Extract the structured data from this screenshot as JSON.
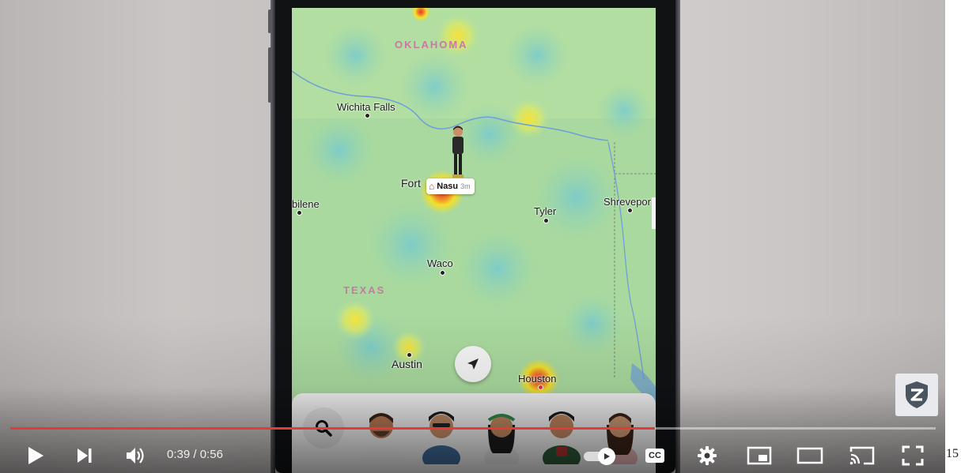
{
  "player": {
    "current_time": "0:39",
    "duration": "0:56",
    "time_separator": " / ",
    "progress": 0.697,
    "progress_color": "#e53935"
  },
  "map": {
    "state_labels": [
      "OKLAHOMA",
      "TEXAS"
    ],
    "cities": [
      "Wichita Falls",
      "Fort",
      "bilene",
      "Tyler",
      "Shrevepor",
      "Waco",
      "Austin",
      "Houston"
    ],
    "friend_chip": {
      "name": "Nasu",
      "time": "3m",
      "icon": "home-icon"
    }
  },
  "edge_text": "15",
  "icons": {
    "play": "play-icon",
    "next": "next-icon",
    "volume": "volume-icon",
    "autoplay": "autoplay-toggle",
    "cc": "CC",
    "settings": "gear-icon",
    "miniplayer": "miniplayer-icon",
    "theater": "theater-icon",
    "cast": "cast-icon",
    "fullscreen": "fullscreen-icon",
    "locate": "location-arrow-icon",
    "search": "search-icon"
  },
  "colors": {
    "heat_hot": "#e8382c",
    "heat_warm": "#f3e02a",
    "map_base": "#a9d99e",
    "water": "#6f9fd8"
  }
}
